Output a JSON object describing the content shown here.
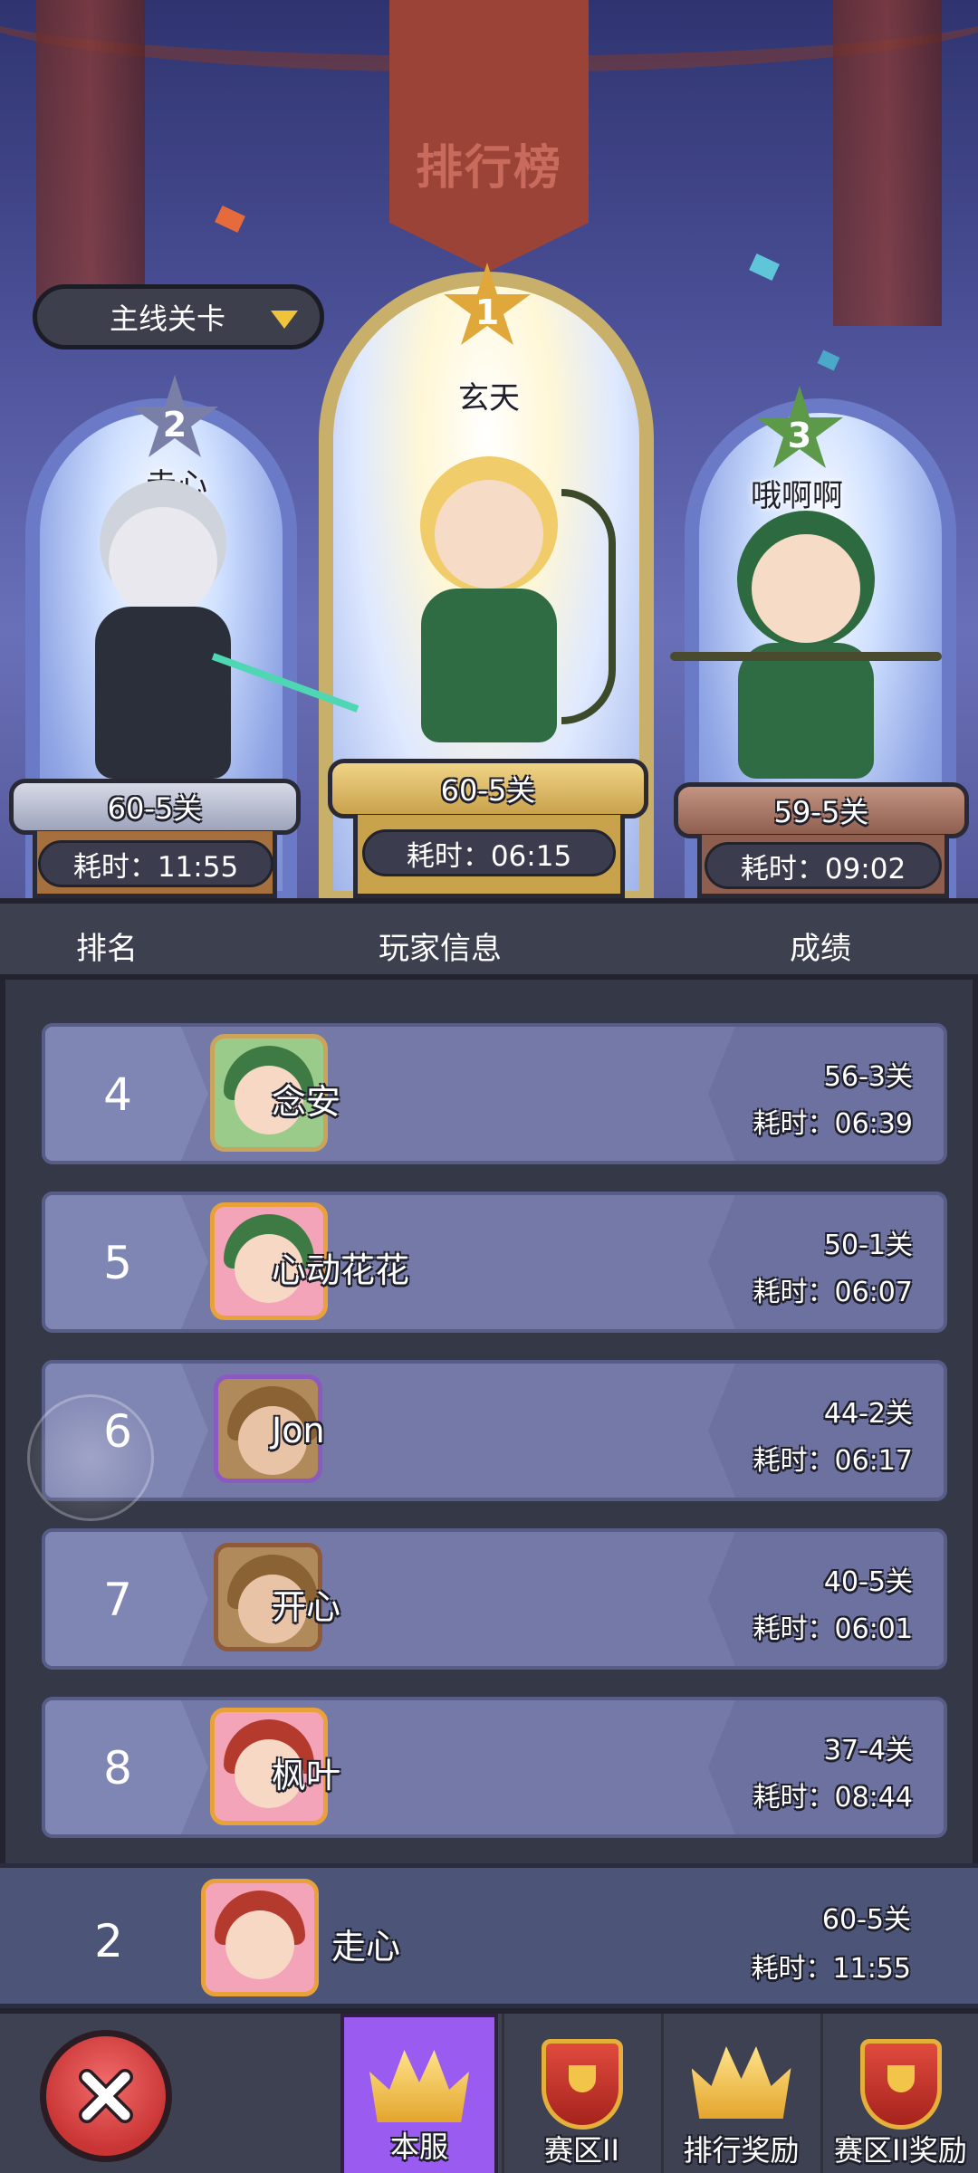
{
  "header": {
    "title": "排行榜"
  },
  "dropdown": {
    "value": "主线关卡"
  },
  "podium": [
    {
      "rank": "1",
      "name": "玄天",
      "stage": "60-5关",
      "time": "耗时：06:15"
    },
    {
      "rank": "2",
      "name": "走心",
      "stage": "60-5关",
      "time": "耗时：11:55"
    },
    {
      "rank": "3",
      "name": "哦啊啊",
      "stage": "59-5关",
      "time": "耗时：09:02"
    }
  ],
  "columns": {
    "rank": "排名",
    "player": "玩家信息",
    "score": "成绩"
  },
  "rows": [
    {
      "rank": "4",
      "name": "念安",
      "stage": "56-3关",
      "time": "耗时：06:39"
    },
    {
      "rank": "5",
      "name": "心动花花",
      "stage": "50-1关",
      "time": "耗时：06:07"
    },
    {
      "rank": "6",
      "name": "Jon",
      "stage": "44-2关",
      "time": "耗时：06:17"
    },
    {
      "rank": "7",
      "name": "开心",
      "stage": "40-5关",
      "time": "耗时：06:01"
    },
    {
      "rank": "8",
      "name": "枫叶",
      "stage": "37-4关",
      "time": "耗时：08:44"
    }
  ],
  "my_row": {
    "rank": "2",
    "name": "走心",
    "stage": "60-5关",
    "time": "耗时：11:55"
  },
  "tabs": [
    {
      "label": "本服",
      "icon": "crown-icon",
      "active": true
    },
    {
      "label": "赛区II",
      "icon": "trophy-shield-icon",
      "active": false
    },
    {
      "label": "排行奖励",
      "icon": "crown-icon",
      "active": false
    },
    {
      "label": "赛区II奖励",
      "icon": "trophy-shield-icon",
      "active": false
    }
  ],
  "colors": {
    "active_tab": "#9a5cf0",
    "row_bg": "#7479a8",
    "close_button": "#d94040"
  }
}
